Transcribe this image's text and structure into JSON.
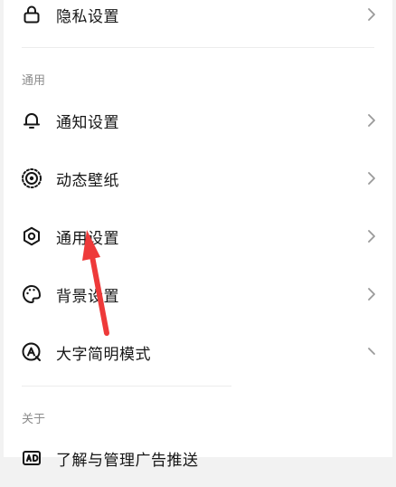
{
  "rows": [
    {
      "label": "隐私设置",
      "icon": "lock-icon"
    },
    {
      "label": "通知设置",
      "icon": "bell-icon"
    },
    {
      "label": "动态壁纸",
      "icon": "live-wallpaper-icon"
    },
    {
      "label": "通用设置",
      "icon": "gear-icon"
    },
    {
      "label": "背景设置",
      "icon": "palette-icon"
    },
    {
      "label": "大字简明模式",
      "icon": "large-text-icon"
    },
    {
      "label": "了解与管理广告推送",
      "icon": "ad-icon"
    }
  ],
  "sections": {
    "general": "通用",
    "about": "关于"
  },
  "annotation": {
    "type": "red-arrow",
    "target": "通用设置",
    "color": "#ee3a3a"
  }
}
